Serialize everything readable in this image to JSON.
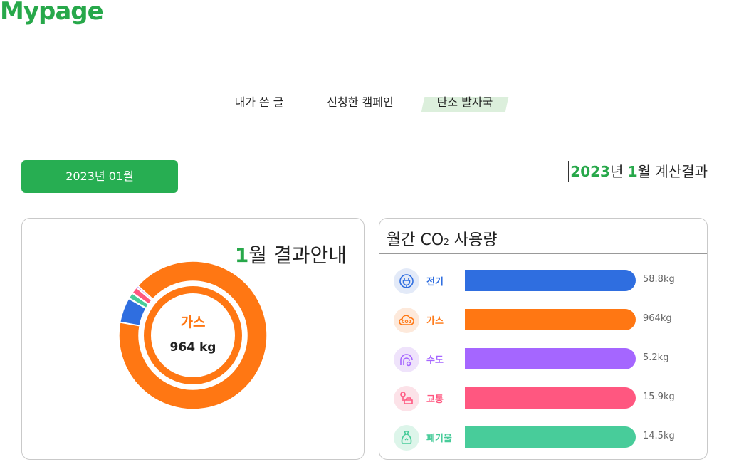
{
  "page": {
    "title": "Mypage"
  },
  "tabs": [
    {
      "label": "내가 쓴 글",
      "active": false
    },
    {
      "label": "신청한 캠페인",
      "active": false
    },
    {
      "label": "탄소 발자국",
      "active": true
    }
  ],
  "date_selector": {
    "label": "2023년 01월"
  },
  "calc_result": {
    "year": "2023",
    "year_suffix": "년 ",
    "month": "1",
    "month_suffix": "월 계산결과"
  },
  "summary": {
    "month": "1",
    "heading_suffix": "월 결과안내",
    "center_category": "가스",
    "center_value": "964 kg"
  },
  "usage": {
    "title_prefix": "월간 CO",
    "title_sub": "2",
    "title_suffix": " 사용량",
    "items": [
      {
        "label": "전기",
        "value": "58.8kg",
        "amount": 58.8,
        "color": "#2f6ee0",
        "icon": "plug-icon",
        "tint": "#e3eaf8"
      },
      {
        "label": "가스",
        "value": "964kg",
        "amount": 964,
        "color": "#ff7713",
        "icon": "cloud-co2-icon",
        "tint": "#fde9db"
      },
      {
        "label": "수도",
        "value": "5.2kg",
        "amount": 5.2,
        "color": "#a566ff",
        "icon": "faucet-icon",
        "tint": "#efe3fb"
      },
      {
        "label": "교통",
        "value": "15.9kg",
        "amount": 15.9,
        "color": "#ff5780",
        "icon": "car-person-icon",
        "tint": "#fce2e8"
      },
      {
        "label": "폐기물",
        "value": "14.5kg",
        "amount": 14.5,
        "color": "#48cc9a",
        "icon": "recycle-bag-icon",
        "tint": "#ddf5ea"
      }
    ]
  }
}
